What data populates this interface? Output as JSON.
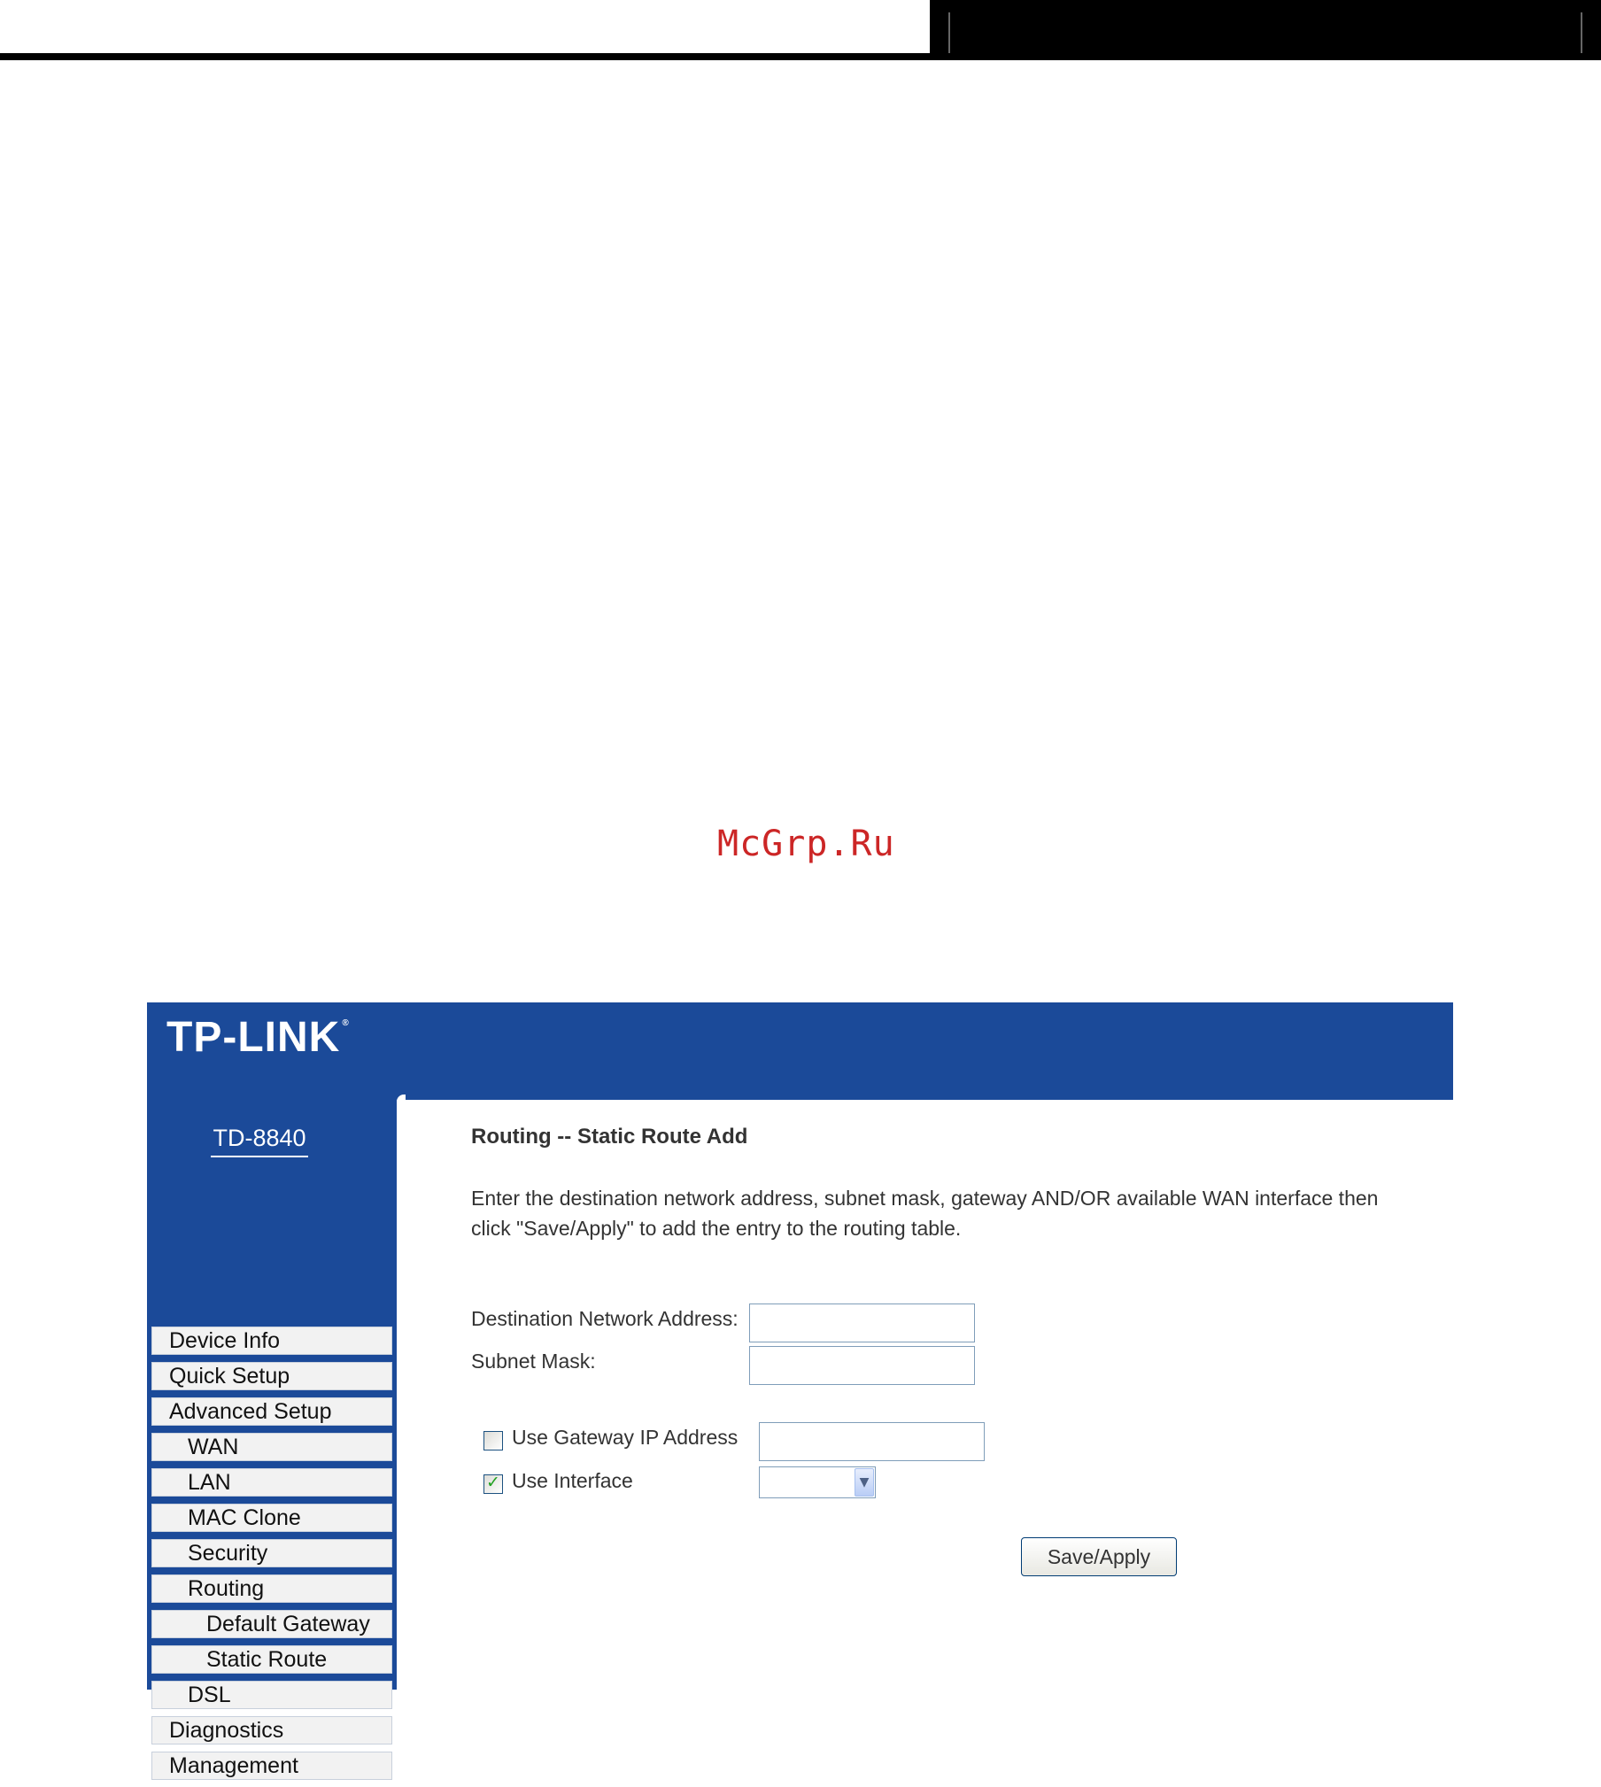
{
  "watermark": "McGrp.Ru",
  "router": {
    "brand": "TP-LINK",
    "brand_mark": "®",
    "model": "TD-8840",
    "menu": [
      {
        "label": "Device Info"
      },
      {
        "label": "Quick Setup"
      },
      {
        "label": "Advanced Setup"
      },
      {
        "label": "WAN"
      },
      {
        "label": "LAN"
      },
      {
        "label": "MAC Clone"
      },
      {
        "label": "Security"
      },
      {
        "label": "Routing"
      },
      {
        "label": "Default Gateway"
      },
      {
        "label": "Static Route"
      },
      {
        "label": "DSL"
      },
      {
        "label": "Diagnostics"
      },
      {
        "label": "Management"
      }
    ],
    "page": {
      "title": "Routing -- Static Route Add",
      "intro_line1": "Enter the destination network address, subnet mask, gateway AND/OR available WAN interface then",
      "intro_line2": "click \"Save/Apply\" to add the entry to the routing table.",
      "dest_label": "Destination Network Address:",
      "dest_value": "",
      "mask_label": "Subnet Mask:",
      "mask_value": "",
      "use_gateway_label": "Use Gateway IP Address",
      "use_gateway_checked": false,
      "gateway_value": "",
      "use_interface_label": "Use Interface",
      "use_interface_checked": true,
      "interface_selected": "",
      "save_label": "Save/Apply"
    }
  },
  "colors": {
    "brand_blue": "#1b4a99",
    "watermark_red": "#cc2626"
  }
}
